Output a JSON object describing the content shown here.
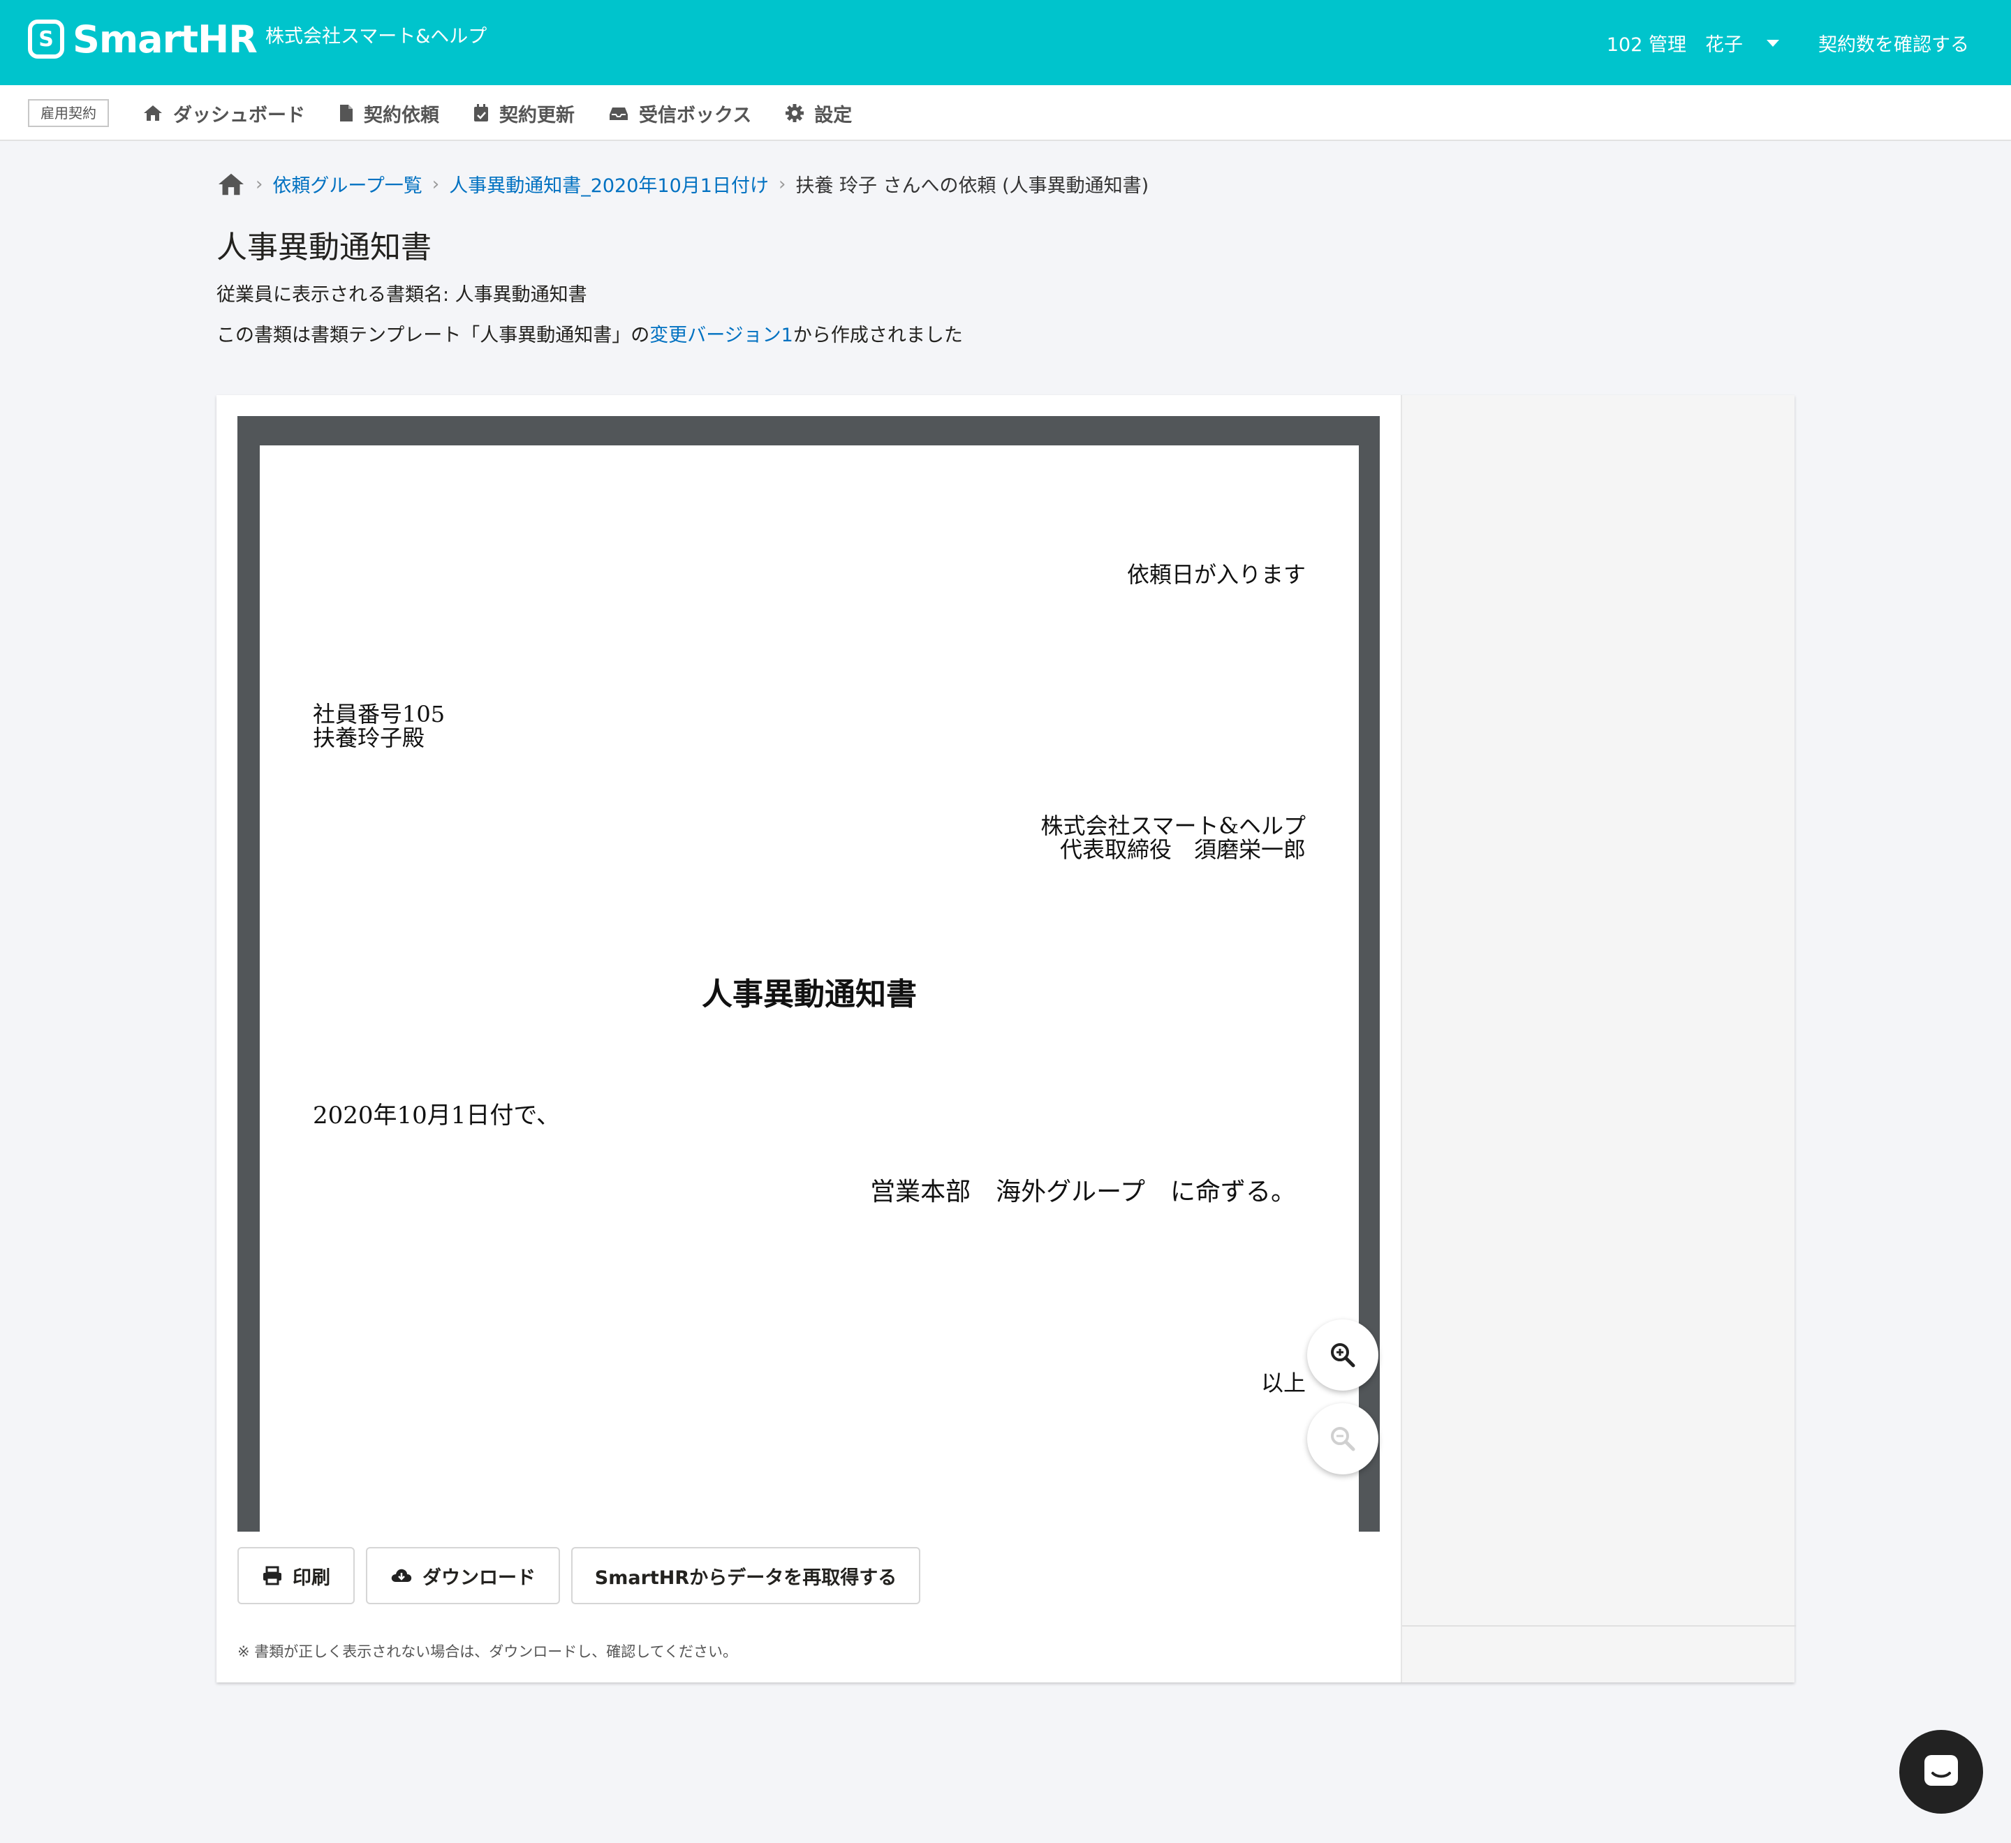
{
  "header": {
    "logo_mark": "S",
    "logo_text": "SmartHR",
    "company": "株式会社スマート&ヘルプ",
    "user": "102 管理　花子",
    "contract_link": "契約数を確認する"
  },
  "nav": {
    "badge": "雇用契約",
    "items": [
      {
        "label": "ダッシュボード",
        "icon": "home-icon"
      },
      {
        "label": "契約依頼",
        "icon": "document-icon"
      },
      {
        "label": "契約更新",
        "icon": "calendar-icon"
      },
      {
        "label": "受信ボックス",
        "icon": "inbox-icon"
      },
      {
        "label": "設定",
        "icon": "gear-icon"
      }
    ]
  },
  "breadcrumb": {
    "items": [
      "依頼グループ一覧",
      "人事異動通知書_2020年10月1日付け"
    ],
    "current": "扶養 玲子 さんへの依頼 (人事異動通知書)"
  },
  "page": {
    "title": "人事異動通知書",
    "display_name": "従業員に表示される書類名: 人事異動通知書",
    "template_prefix": "この書類は書類テンプレート「人事異動通知書」の",
    "template_link": "変更バージョン1",
    "template_suffix": "から作成されました"
  },
  "document": {
    "date": "依頼日が入ります",
    "employee_no": "社員番号105",
    "employee_name": "扶養玲子殿",
    "company": "株式会社スマート&ヘルプ",
    "representative": "代表取締役　須磨栄一郎",
    "title": "人事異動通知書",
    "line1": "2020年10月1日付で、",
    "line2": "営業本部　海外グループ　に命ずる。",
    "end": "以上"
  },
  "actions": {
    "print": "印刷",
    "download": "ダウンロード",
    "refetch": "SmartHRからデータを再取得する",
    "note": "※ 書類が正しく表示されない場合は、ダウンロードし、確認してください。"
  },
  "colors": {
    "brand": "#00c4cc",
    "link": "#0071c1"
  }
}
